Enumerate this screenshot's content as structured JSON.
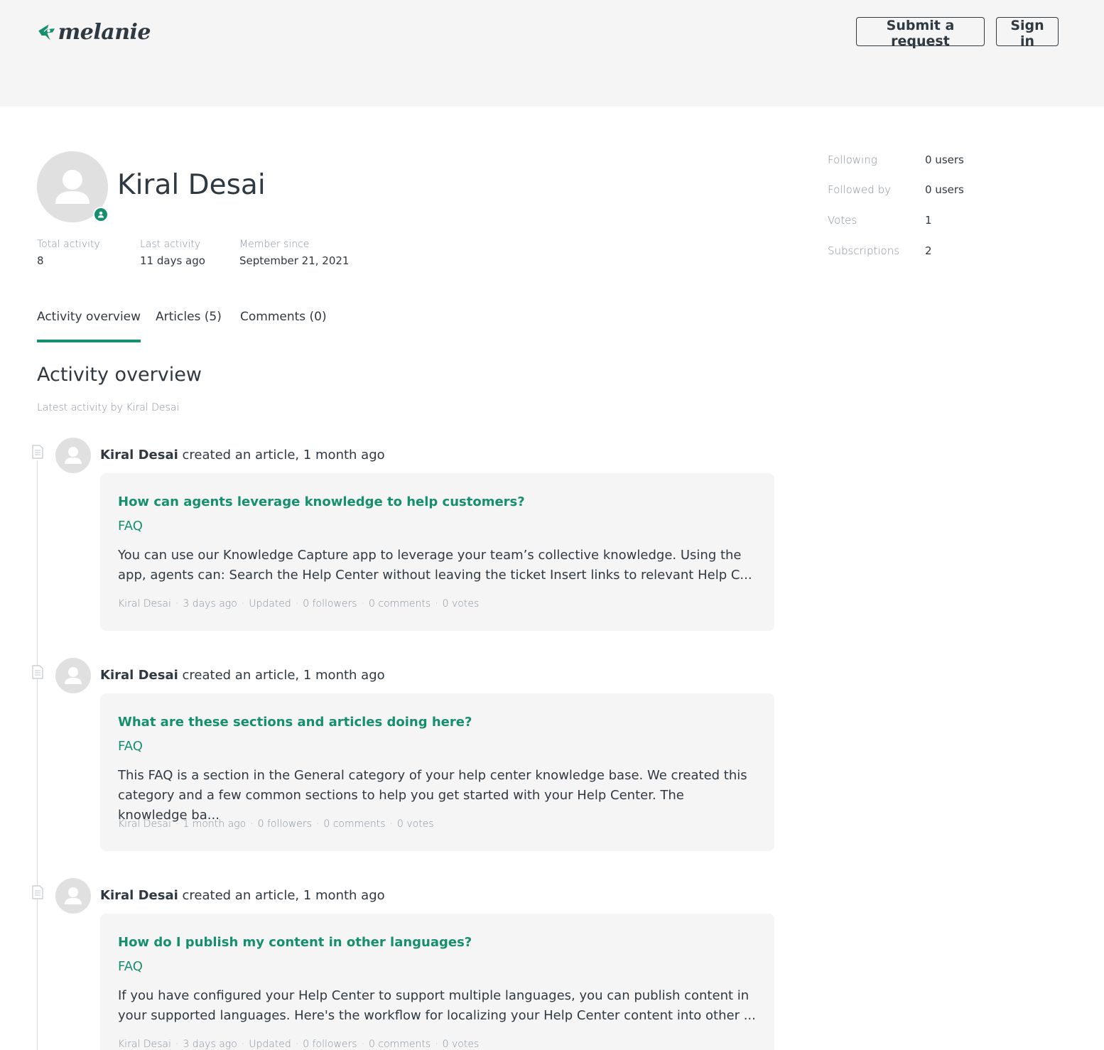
{
  "header": {
    "logo_text": "melanie",
    "submit_label": "Submit a request",
    "signin_label": "Sign in",
    "brand_color": "#168f6e"
  },
  "profile": {
    "name": "Kiral Desai",
    "stats": [
      {
        "label": "Total activity",
        "value": "8"
      },
      {
        "label": "Last activity",
        "value": "11 days ago"
      },
      {
        "label": "Member since",
        "value": "September 21, 2021"
      }
    ],
    "side": [
      {
        "label": "Following",
        "value": "0 users"
      },
      {
        "label": "Followed by",
        "value": "0 users"
      },
      {
        "label": "Votes",
        "value": "1"
      },
      {
        "label": "Subscriptions",
        "value": "2"
      }
    ]
  },
  "tabs": [
    {
      "label": "Activity overview",
      "active": true
    },
    {
      "label": "Articles (5)",
      "active": false
    },
    {
      "label": "Comments (0)",
      "active": false
    }
  ],
  "overview": {
    "title": "Activity overview",
    "subtitle": "Latest activity by Kiral Desai"
  },
  "activities": [
    {
      "author": "Kiral Desai",
      "action": "created an article, 1 month ago",
      "title": "How can agents leverage knowledge to help customers?",
      "category": "FAQ",
      "excerpt": "You can use our Knowledge Capture app to leverage your team’s collective knowledge. Using the app, agents can: Search the Help Center without leaving the ticket Insert links to relevant Help C...",
      "meta": [
        "Kiral Desai",
        "3 days ago",
        "Updated",
        "0 followers",
        "0 comments",
        "0 votes"
      ]
    },
    {
      "author": "Kiral Desai",
      "action": "created an article, 1 month ago",
      "title": "What are these sections and articles doing here?",
      "category": "FAQ",
      "excerpt": "This FAQ is a section in the General category of your help center knowledge base. We created this category and a few common sections to help you get started with your Help Center. The knowledge ba...",
      "meta": [
        "Kiral Desai",
        "1 month ago",
        "0 followers",
        "0 comments",
        "0 votes"
      ]
    },
    {
      "author": "Kiral Desai",
      "action": "created an article, 1 month ago",
      "title": "How do I publish my content in other languages?",
      "category": "FAQ",
      "excerpt": "If you have configured your Help Center to support multiple languages, you can publish content in your supported languages. Here's the workflow for localizing your Help Center content into other ...",
      "meta": [
        "Kiral Desai",
        "3 days ago",
        "Updated",
        "0 followers",
        "0 comments",
        "0 votes"
      ]
    }
  ]
}
